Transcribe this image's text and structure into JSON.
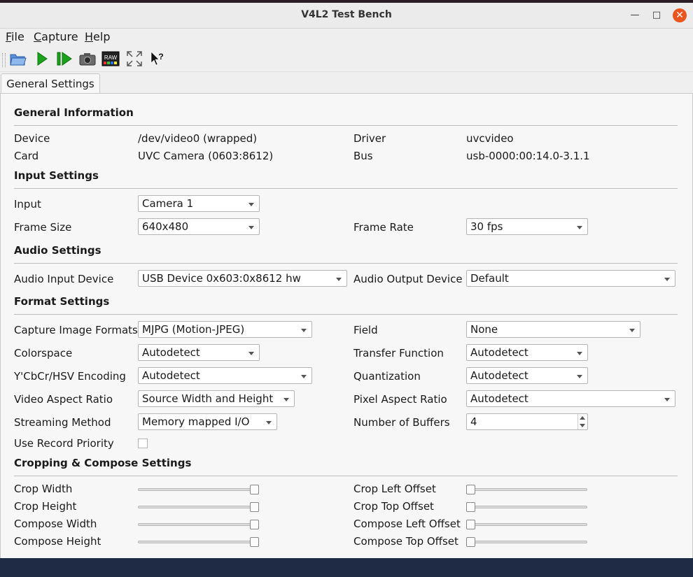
{
  "window": {
    "title": "V4L2 Test Bench"
  },
  "menu": {
    "file": {
      "mnemonic": "F",
      "rest": "ile"
    },
    "capture": {
      "mnemonic": "C",
      "rest": "apture"
    },
    "help": {
      "mnemonic": "H",
      "rest": "elp"
    }
  },
  "toolbar": {
    "icons": [
      "open-icon",
      "start-capture-icon",
      "step-capture-icon",
      "snapshot-icon",
      "raw-icon",
      "fullscreen-icon",
      "whats-this-icon"
    ],
    "raw_label": "RAW",
    "whats_this_glyph": "?"
  },
  "tabs": [
    {
      "label": "General Settings"
    }
  ],
  "general_info": {
    "title": "General Information",
    "device_label": "Device",
    "device_value": "/dev/video0 (wrapped)",
    "driver_label": "Driver",
    "driver_value": "uvcvideo",
    "card_label": "Card",
    "card_value": "UVC Camera (0603:8612)",
    "bus_label": "Bus",
    "bus_value": "usb-0000:00:14.0-3.1.1"
  },
  "input_settings": {
    "title": "Input Settings",
    "input_label": "Input",
    "input_value": "Camera 1",
    "frame_size_label": "Frame Size",
    "frame_size_value": "640x480",
    "frame_rate_label": "Frame Rate",
    "frame_rate_value": "30 fps"
  },
  "audio_settings": {
    "title": "Audio Settings",
    "input_device_label": "Audio Input Device",
    "input_device_value": "USB Device 0x603:0x8612 hw",
    "output_device_label": "Audio Output Device",
    "output_device_value": "Default"
  },
  "format_settings": {
    "title": "Format Settings",
    "capture_formats_label": "Capture Image Formats",
    "capture_formats_value": "MJPG (Motion-JPEG)",
    "field_label": "Field",
    "field_value": "None",
    "colorspace_label": "Colorspace",
    "colorspace_value": "Autodetect",
    "transfer_label": "Transfer Function",
    "transfer_value": "Autodetect",
    "encoding_label": "Y'CbCr/HSV Encoding",
    "encoding_value": "Autodetect",
    "quantization_label": "Quantization",
    "quantization_value": "Autodetect",
    "video_aspect_label": "Video Aspect Ratio",
    "video_aspect_value": "Source Width and Height",
    "pixel_aspect_label": "Pixel Aspect Ratio",
    "pixel_aspect_value": "Autodetect",
    "streaming_label": "Streaming Method",
    "streaming_value": "Memory mapped I/O",
    "buffers_label": "Number of Buffers",
    "buffers_value": "4",
    "record_priority_label": "Use Record Priority",
    "record_priority_checked": false
  },
  "crop_settings": {
    "title": "Cropping & Compose Settings",
    "crop_width_label": "Crop Width",
    "crop_width_level": 1.0,
    "crop_height_label": "Crop Height",
    "crop_height_level": 1.0,
    "compose_width_label": "Compose Width",
    "compose_width_level": 1.0,
    "compose_height_label": "Compose Height",
    "compose_height_level": 1.0,
    "crop_left_label": "Crop Left Offset",
    "crop_left_level": 0.0,
    "crop_top_label": "Crop Top Offset",
    "crop_top_level": 0.0,
    "compose_left_label": "Compose Left Offset",
    "compose_left_level": 0.0,
    "compose_top_label": "Compose Top Offset",
    "compose_top_level": 0.0
  },
  "colors": {
    "accent_close": "#e95420",
    "play_green": "#1aa31a"
  }
}
